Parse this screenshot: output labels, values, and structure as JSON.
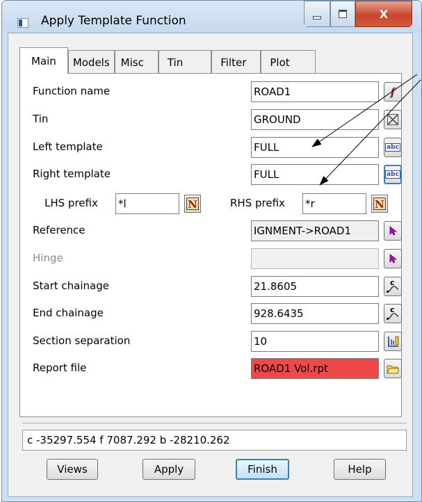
{
  "window": {
    "title": "Apply Template Function",
    "close_glyph": "X"
  },
  "tabs": [
    "Main",
    "Models",
    "Misc",
    "Tin",
    "Filter",
    "Plot"
  ],
  "fields": {
    "function_name": {
      "label": "Function name",
      "value": "ROAD1"
    },
    "tin": {
      "label": "Tin",
      "value": "GROUND"
    },
    "left_template": {
      "label": "Left  template",
      "value": "FULL"
    },
    "right_template": {
      "label": "Right template",
      "value": "FULL"
    },
    "lhs_prefix": {
      "label": "LHS prefix",
      "value": "*l"
    },
    "rhs_prefix": {
      "label": "RHS prefix",
      "value": "*r"
    },
    "reference": {
      "label": "Reference",
      "value": "IGNMENT->ROAD1"
    },
    "hinge": {
      "label": "Hinge",
      "value": ""
    },
    "start_chainage": {
      "label": "Start chainage",
      "value": "21.8605"
    },
    "end_chainage": {
      "label": "End chainage",
      "value": "928.6435"
    },
    "section_separation": {
      "label": "Section separation",
      "value": "10"
    },
    "report_file": {
      "label": "Report file",
      "value": "ROAD1 Vol.rpt"
    }
  },
  "glyphs": {
    "function": "f",
    "abc": "abc",
    "N": "N",
    "chainage": "c"
  },
  "status": {
    "text": "c -35297.554 f  7087.292 b -28210.262"
  },
  "buttons": {
    "views": "Views",
    "apply": "Apply",
    "finish": "Finish",
    "help": "Help"
  },
  "colors": {
    "report_bg": "#ee4848",
    "focus_border": "#3c7fb1",
    "cursor_icon": "#c000c0"
  }
}
